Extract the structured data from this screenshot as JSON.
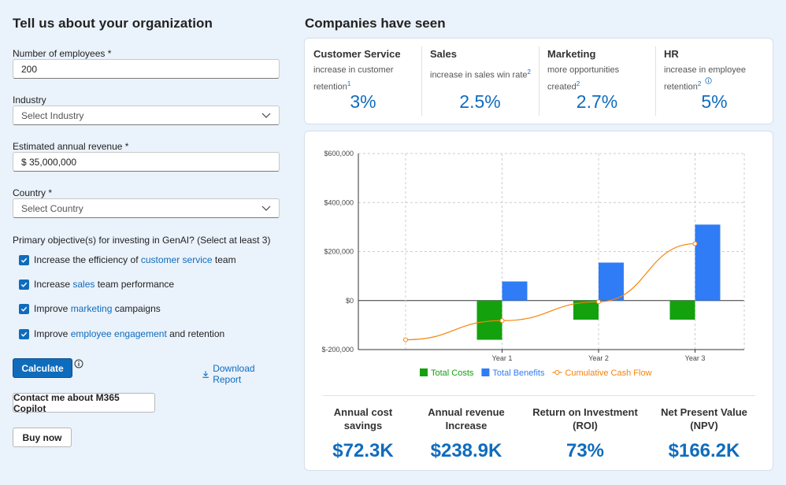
{
  "form": {
    "title": "Tell us about your organization",
    "employees_label": "Number of employees *",
    "employees_value": "200",
    "industry_label": "Industry",
    "industry_placeholder": "Select Industry",
    "revenue_label": "Estimated annual revenue *",
    "revenue_value": "$ 35,000,000",
    "country_label": "Country *",
    "country_placeholder": "Select Country",
    "objectives_label": "Primary objective(s) for investing in GenAI? (Select at least 3)",
    "objectives": [
      {
        "pre": "Increase the efficiency of ",
        "link": "customer service",
        "post": " team",
        "checked": true
      },
      {
        "pre": "Increase ",
        "link": "sales",
        "post": " team performance",
        "checked": true
      },
      {
        "pre": "Improve ",
        "link": "marketing",
        "post": " campaigns",
        "checked": true
      },
      {
        "pre": "Improve ",
        "link": "employee engagement",
        "post": " and retention",
        "checked": true
      }
    ],
    "calculate_label": "Calculate",
    "download_label": "Download Report",
    "contact_label": "Contact me about M365 Copilot",
    "buy_label": "Buy now"
  },
  "companies": {
    "title": "Companies have seen",
    "stats": [
      {
        "name": "Customer Service",
        "desc1": "increase in customer",
        "desc2": "retention",
        "sup": "1",
        "value": "3%"
      },
      {
        "name": "Sales",
        "desc1": "increase in sales win rate",
        "desc2": "",
        "sup": "2",
        "value": "2.5%"
      },
      {
        "name": "Marketing",
        "desc1": "more opportunities",
        "desc2": "created",
        "sup": "2",
        "value": "2.7%"
      },
      {
        "name": "HR",
        "desc1": "increase in employee",
        "desc2": "retention",
        "sup": "2",
        "value": "5%"
      }
    ]
  },
  "chart_data": {
    "type": "bar",
    "categories": [
      "Year 1",
      "Year 2",
      "Year 3"
    ],
    "ylim": [
      -200000,
      600000
    ],
    "yticks": [
      -200000,
      0,
      200000,
      400000,
      600000
    ],
    "ytick_labels": [
      "$-200,000",
      "$0",
      "$200,000",
      "$400,000",
      "$600,000"
    ],
    "series": [
      {
        "name": "Total Costs",
        "type": "bar",
        "color": "#13a10e",
        "values": [
          -160000,
          -78000,
          -78000
        ]
      },
      {
        "name": "Total Benefits",
        "type": "bar",
        "color": "#2f7cf6",
        "values": [
          78000,
          155000,
          310000
        ]
      },
      {
        "name": "Cumulative Cash Flow",
        "type": "line",
        "color": "#f7820a",
        "x": [
          0,
          1,
          2,
          3
        ],
        "values": [
          -160000,
          -82000,
          -5000,
          232000
        ]
      }
    ],
    "grid": true,
    "legend": "bottom"
  },
  "kpis": [
    {
      "label1": "Annual cost",
      "label2": "savings",
      "value": "$72.3K"
    },
    {
      "label1": "Annual revenue",
      "label2": "Increase",
      "value": "$238.9K"
    },
    {
      "label1": "Return on Investment",
      "label2": "(ROI)",
      "value": "73%"
    },
    {
      "label1": "Net Present Value",
      "label2": "(NPV)",
      "value": "$166.2K"
    }
  ]
}
